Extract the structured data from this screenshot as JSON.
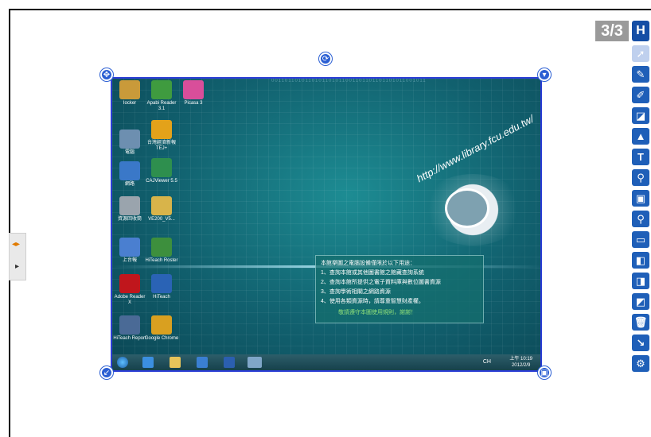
{
  "page_counter": "3/3",
  "toolbar": {
    "items": [
      {
        "icon": "hiteach-logo-icon",
        "glyph": "H"
      },
      {
        "icon": "pointer-icon",
        "glyph": "➚"
      },
      {
        "icon": "pen-icon",
        "glyph": "✎"
      },
      {
        "icon": "brush-icon",
        "glyph": "✐"
      },
      {
        "icon": "eraser-icon",
        "glyph": "◪"
      },
      {
        "icon": "shapes-icon",
        "glyph": "▲"
      },
      {
        "icon": "text-icon",
        "glyph": "T"
      },
      {
        "icon": "link-icon",
        "glyph": "⚲"
      },
      {
        "icon": "capture-icon",
        "glyph": "▣"
      },
      {
        "icon": "zoom-icon",
        "glyph": "⚲"
      },
      {
        "icon": "screen-icon",
        "glyph": "▭"
      },
      {
        "icon": "page-prev-icon",
        "glyph": "◧"
      },
      {
        "icon": "page-next-icon",
        "glyph": "◨"
      },
      {
        "icon": "page-new-icon",
        "glyph": "◩"
      },
      {
        "icon": "trash-icon",
        "glyph": "🗑"
      },
      {
        "icon": "exit-icon",
        "glyph": "↘"
      },
      {
        "icon": "settings-icon",
        "glyph": "⚙"
      }
    ]
  },
  "side_tab": {
    "expand": "◂▸",
    "play": "▸"
  },
  "desktop": {
    "icons": [
      {
        "label": "Iocker",
        "color": "#c99a3a"
      },
      {
        "label": "Apabi Reader 3.1",
        "color": "#3f9b3f"
      },
      {
        "label": "Picasa 3",
        "color": "#d94e9a"
      },
      {
        "label": "電腦",
        "color": "#6d8fb0"
      },
      {
        "label": "台灣經濟新報 TEJ+",
        "color": "#e3a21a"
      },
      {
        "label": "網路",
        "color": "#3a78c8"
      },
      {
        "label": "CAJViewer 5.5",
        "color": "#2e8f4e"
      },
      {
        "label": "資源回收筒",
        "color": "#9aa4ad"
      },
      {
        "label": "VE200_V5...",
        "color": "#d8b44a"
      },
      {
        "label": "上台報",
        "color": "#4a7fd0"
      },
      {
        "label": "HiTeach Roster",
        "color": "#3d8f3d"
      },
      {
        "label": "Adobe Reader X",
        "color": "#c0161c"
      },
      {
        "label": "HiTeach",
        "color": "#2a63b5"
      },
      {
        "label": "HiTeach Report",
        "color": "#4a6a96"
      },
      {
        "label": "Google Chrome",
        "color": "#d9a020"
      }
    ],
    "binary_text": "0011011010110101101011001101101101101011001011",
    "url_text": "http://www.library.fcu.edu.tw/",
    "notice_lines": [
      "本館樂圖之電腦設備僅限於以下用途：",
      "1、查詢本館或其他圖書館之館藏查詢系統",
      "2、查詢本館所提供之電子資料庫與數位圖書資源",
      "3、查詢學術相關之網路資源",
      "4、使用各類資源時，請尊重智慧財產權。"
    ],
    "notice_footer": "敬請遵守本圖使用規則，謝謝！",
    "taskbar": {
      "lang": "CH",
      "time": "上午 10:19",
      "date": "2012/2/9"
    }
  }
}
